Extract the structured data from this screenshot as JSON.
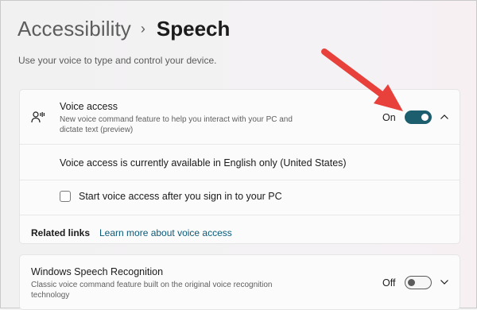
{
  "breadcrumb": {
    "parent": "Accessibility",
    "separator": "›",
    "current": "Speech"
  },
  "subtitle": "Use your voice to type and control your device.",
  "voice_access": {
    "icon": "voice-access-icon",
    "title": "Voice access",
    "description_line1": "New voice command feature to help you interact with your PC and",
    "description_line2": "dictate text (preview)",
    "toggle_state": "On",
    "toggle_on": true,
    "expanded": true,
    "accent_color": "#1c5d6e"
  },
  "availability_note": "Voice access is currently available in English only (United States)",
  "start_checkbox": {
    "label": "Start voice access after you sign in to your PC",
    "checked": false
  },
  "related_links": {
    "label": "Related links",
    "link": "Learn more about voice access",
    "link_color": "#0a5a78"
  },
  "speech_recognition": {
    "title": "Windows Speech Recognition",
    "description_line1": "Classic voice command feature built on the original voice recognition",
    "description_line2": "technology",
    "toggle_state": "Off",
    "toggle_on": false,
    "expanded": false
  },
  "annotation": {
    "arrow_color": "#e8413c"
  }
}
